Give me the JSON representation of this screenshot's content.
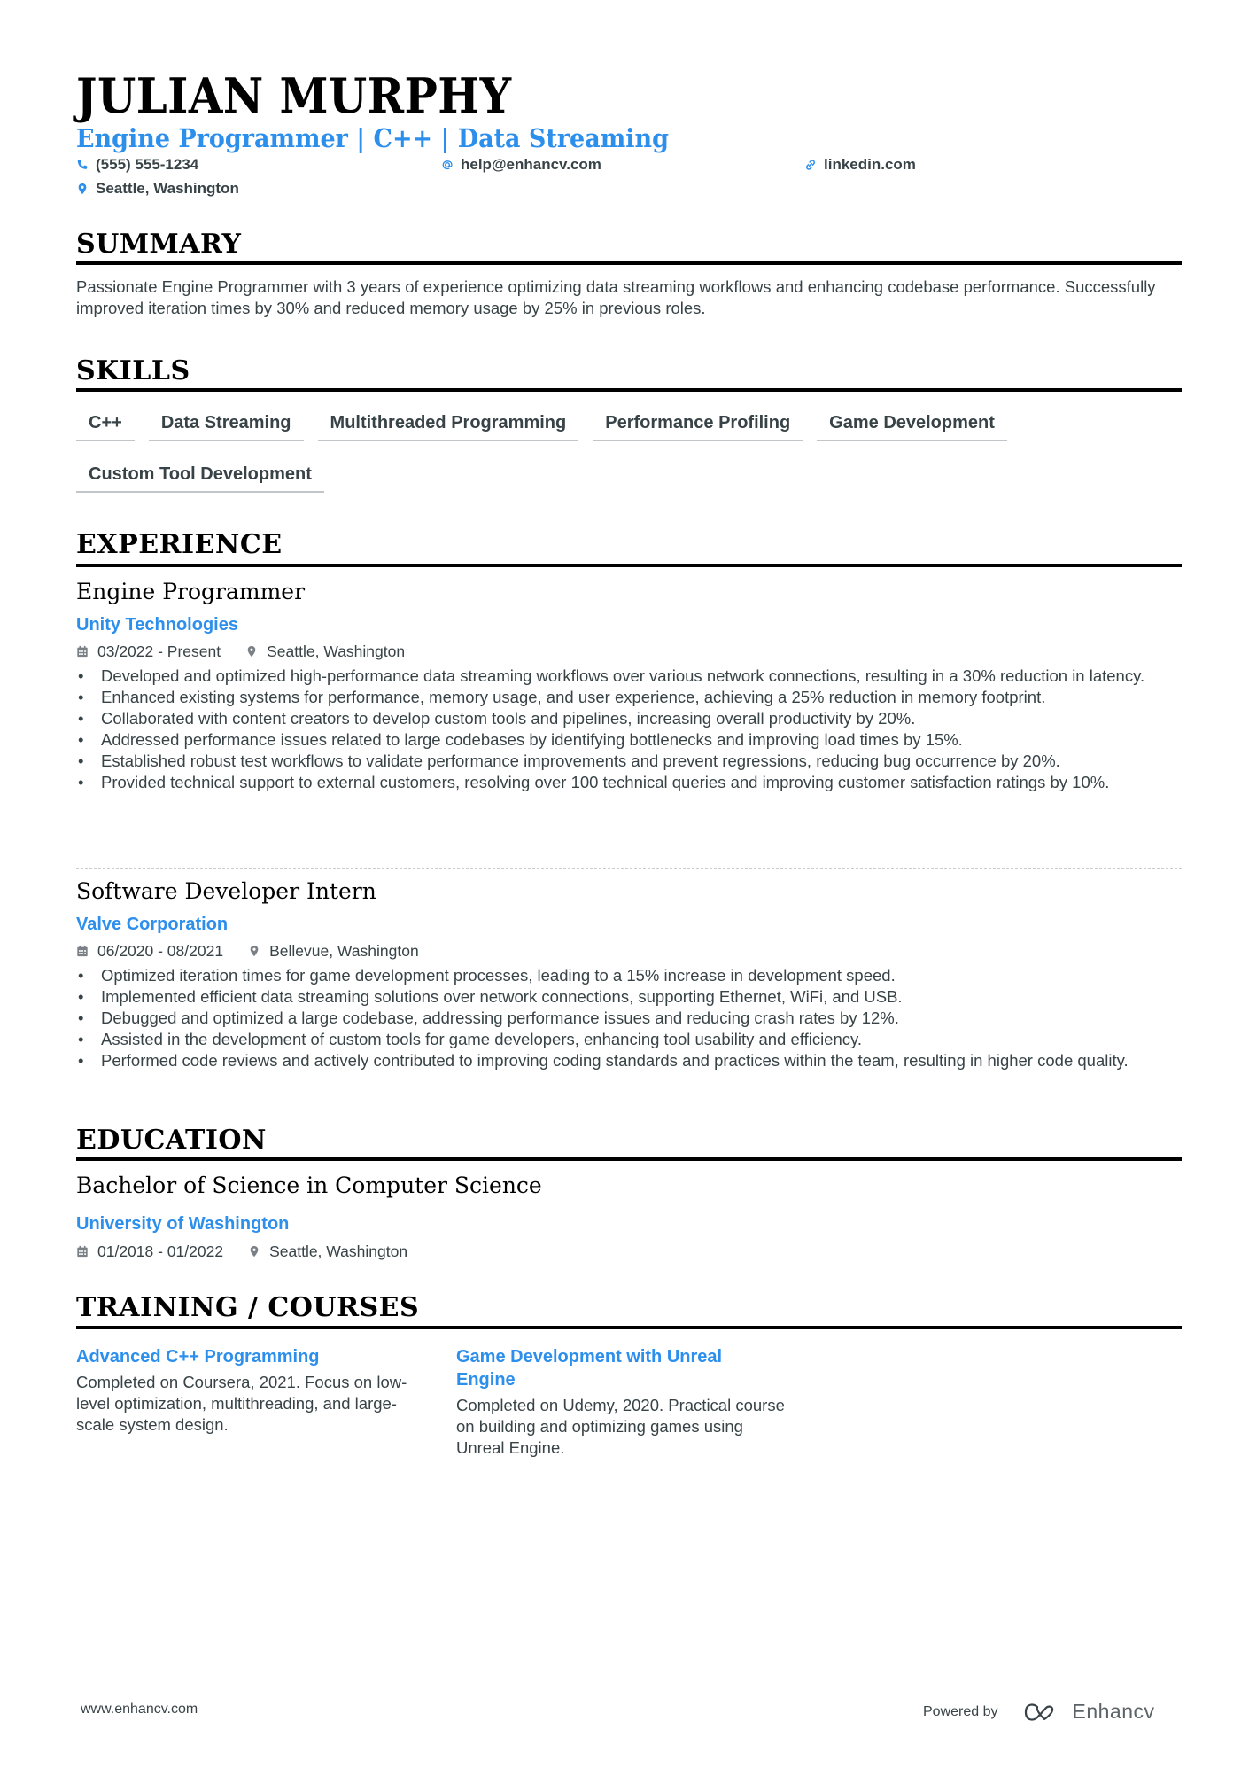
{
  "header": {
    "name": "JULIAN MURPHY",
    "headline": "Engine Programmer | C++ | Data Streaming",
    "phone": "(555) 555-1234",
    "email": "help@enhancv.com",
    "link": "linkedin.com",
    "location": "Seattle, Washington"
  },
  "icons": {
    "phone": "phone-icon",
    "email": "at-icon",
    "link": "link-icon",
    "location": "map-pin-icon",
    "date": "calendar-icon"
  },
  "colors": {
    "accent": "#2d8fec",
    "text": "#384347",
    "heading": "#000000"
  },
  "summary": {
    "title": "SUMMARY",
    "text": "Passionate Engine Programmer with 3 years of experience optimizing data streaming workflows and enhancing codebase performance. Successfully improved iteration times by 30% and reduced memory usage by 25% in previous roles."
  },
  "skills": {
    "title": "SKILLS",
    "items": [
      "C++",
      "Data Streaming",
      "Multithreaded Programming",
      "Performance Profiling",
      "Game Development",
      "Custom Tool Development"
    ]
  },
  "experience": {
    "title": "EXPERIENCE",
    "jobs": [
      {
        "title": "Engine Programmer",
        "company": "Unity Technologies",
        "dates": "03/2022 - Present",
        "location": "Seattle, Washington",
        "bullets": [
          "Developed and optimized high-performance data streaming workflows over various network connections, resulting in a 30% reduction in latency.",
          "Enhanced existing systems for performance, memory usage, and user experience, achieving a 25% reduction in memory footprint.",
          "Collaborated with content creators to develop custom tools and pipelines, increasing overall productivity by 20%.",
          "Addressed performance issues related to large codebases by identifying bottlenecks and improving load times by 15%.",
          "Established robust test workflows to validate performance improvements and prevent regressions, reducing bug occurrence by 20%.",
          "Provided technical support to external customers, resolving over 100 technical queries and improving customer satisfaction ratings by 10%."
        ]
      },
      {
        "title": "Software Developer Intern",
        "company": "Valve Corporation",
        "dates": "06/2020 - 08/2021",
        "location": "Bellevue, Washington",
        "bullets": [
          "Optimized iteration times for game development processes, leading to a 15% increase in development speed.",
          "Implemented efficient data streaming solutions over network connections, supporting Ethernet, WiFi, and USB.",
          "Debugged and optimized a large codebase, addressing performance issues and reducing crash rates by 12%.",
          "Assisted in the development of custom tools for game developers, enhancing tool usability and efficiency.",
          "Performed code reviews and actively contributed to improving coding standards and practices within the team, resulting in higher code quality."
        ]
      }
    ]
  },
  "education": {
    "title": "EDUCATION",
    "degree": "Bachelor of Science in Computer Science",
    "school": "University of Washington",
    "dates": "01/2018 - 01/2022",
    "location": "Seattle, Washington"
  },
  "training": {
    "title": "TRAINING / COURSES",
    "courses": [
      {
        "title": "Advanced C++ Programming",
        "description": "Completed on Coursera, 2021. Focus on low-level optimization, multithreading, and large-scale system design."
      },
      {
        "title": "Game Development with Unreal Engine",
        "description": "Completed on Udemy, 2020. Practical course on building and optimizing games using Unreal Engine."
      }
    ]
  },
  "footer": {
    "url": "www.enhancv.com",
    "powered_by": "Powered by",
    "brand": "Enhancv"
  }
}
